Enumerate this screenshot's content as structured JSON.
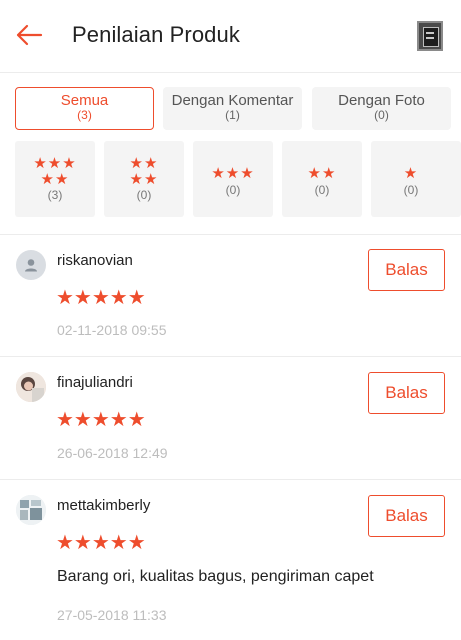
{
  "header": {
    "title": "Penilaian Produk",
    "back_icon": "arrow-left-icon",
    "accent": "#ee4d2d"
  },
  "filters": [
    {
      "label": "Semua",
      "count": "(3)",
      "active": true
    },
    {
      "label": "Dengan Komentar",
      "count": "(1)",
      "active": false
    },
    {
      "label": "Dengan Foto",
      "count": "(0)",
      "active": false
    }
  ],
  "star_filters": [
    {
      "stars_row1": "★★★",
      "stars_row2": "★★",
      "stars": 5,
      "count": "(3)"
    },
    {
      "stars_row1": "★★",
      "stars_row2": "★★",
      "stars": 4,
      "count": "(0)"
    },
    {
      "stars_row1": "★★★",
      "stars_row2": "",
      "stars": 3,
      "count": "(0)"
    },
    {
      "stars_row1": "★★",
      "stars_row2": "",
      "stars": 2,
      "count": "(0)"
    },
    {
      "stars_row1": "★",
      "stars_row2": "",
      "stars": 1,
      "count": "(0)"
    }
  ],
  "reviews": [
    {
      "username": "riskanovian",
      "stars": "★★★★★",
      "rating": 5,
      "comment": "",
      "date": "02-11-2018 09:55",
      "reply_label": "Balas"
    },
    {
      "username": "finajuliandri",
      "stars": "★★★★★",
      "rating": 5,
      "comment": "",
      "date": "26-06-2018 12:49",
      "reply_label": "Balas"
    },
    {
      "username": "mettakimberly",
      "stars": "★★★★★",
      "rating": 5,
      "comment": "Barang ori, kualitas bagus, pengiriman capet",
      "date": "27-05-2018 11:33",
      "reply_label": "Balas"
    }
  ]
}
